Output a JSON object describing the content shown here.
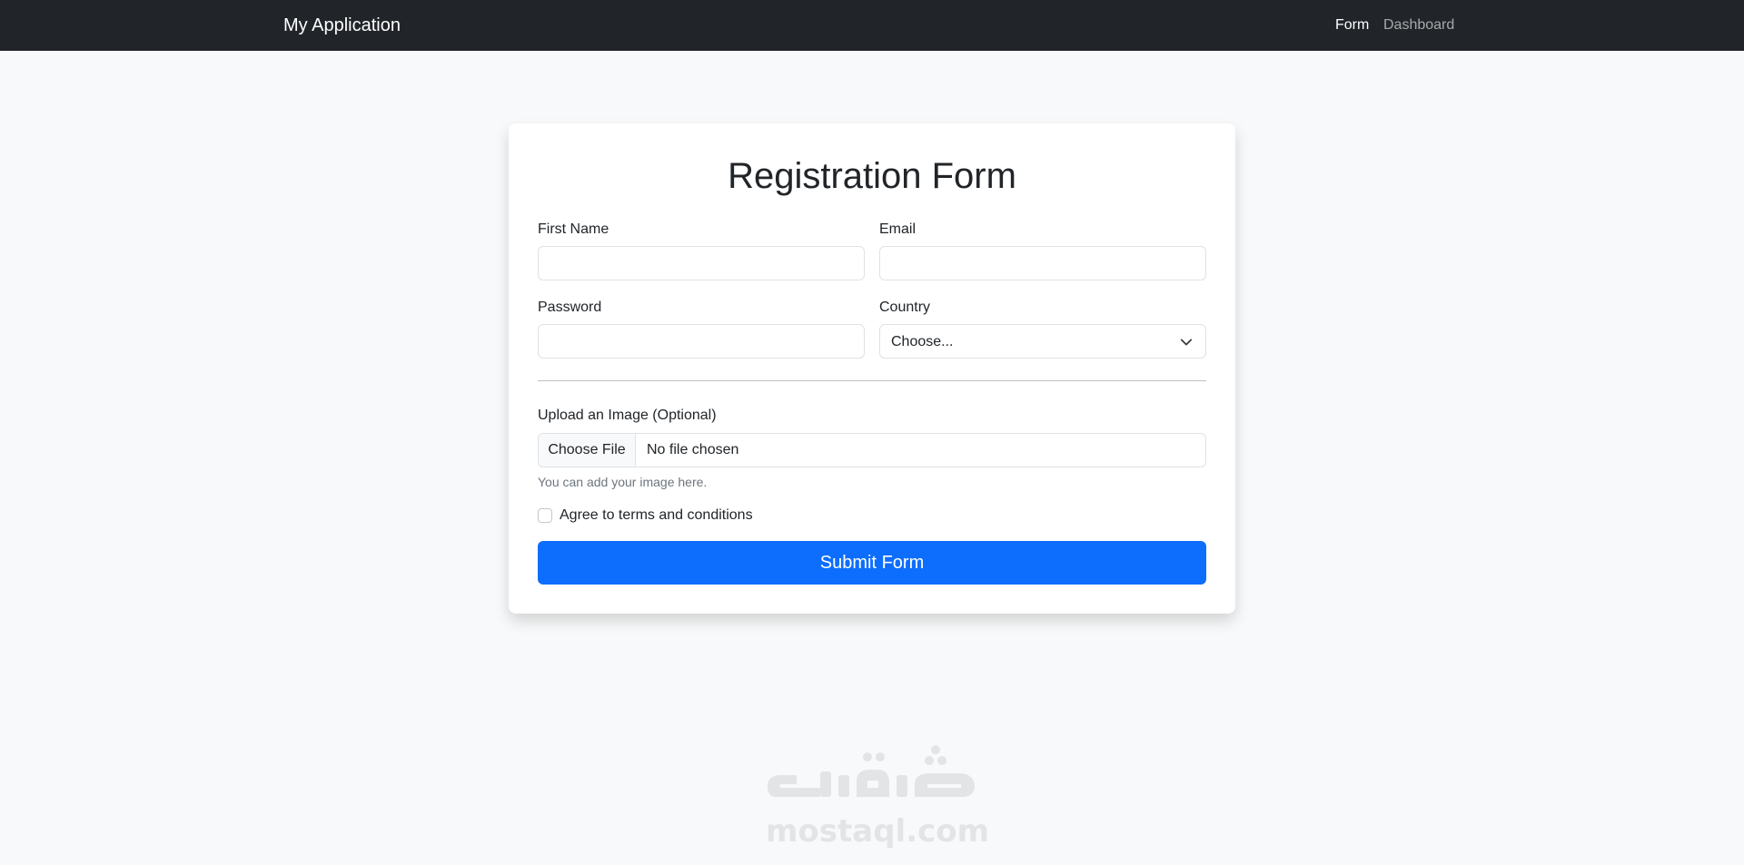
{
  "navbar": {
    "brand": "My Application",
    "links": [
      {
        "label": "Form",
        "active": true
      },
      {
        "label": "Dashboard",
        "active": false
      }
    ]
  },
  "form": {
    "title": "Registration Form",
    "fields": {
      "first_name": {
        "label": "First Name",
        "value": ""
      },
      "email": {
        "label": "Email",
        "value": ""
      },
      "password": {
        "label": "Password",
        "value": ""
      },
      "country": {
        "label": "Country",
        "selected": "Choose..."
      }
    },
    "upload": {
      "label": "Upload an Image (Optional)",
      "button": "Choose File",
      "status": "No file chosen",
      "help": "You can add your image here."
    },
    "terms": {
      "label": "Agree to terms and conditions",
      "checked": false
    },
    "submit": "Submit Form"
  },
  "watermark": {
    "arabic": "مستقل",
    "latin": "mostaql.com"
  },
  "colors": {
    "navbar_bg": "#212529",
    "page_bg": "#f8f9fa",
    "primary": "#0d6efd"
  }
}
